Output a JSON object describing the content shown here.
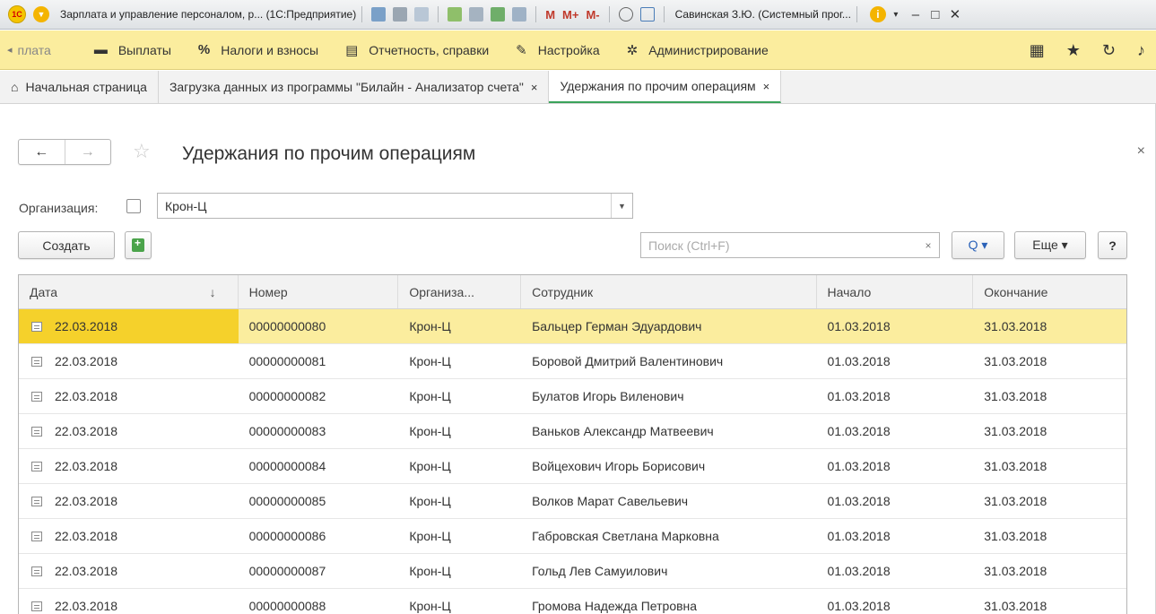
{
  "window": {
    "logo": "1С",
    "title": "Зарплата и управление персоналом, р... (1С:Предприятие)",
    "m_labels": [
      "M",
      "M+",
      "M-"
    ],
    "user": "Савинская З.Ю. (Системный прог...",
    "info": "i",
    "minimize": "–",
    "maximize": "□",
    "close": "✕"
  },
  "sections": {
    "items": [
      {
        "label": "плата",
        "icon": "arrow-left-icon",
        "glyph": "◂"
      },
      {
        "label": "Выплаты",
        "icon": "payments-icon",
        "glyph": "▬"
      },
      {
        "label": "Налоги и взносы",
        "icon": "percent-icon",
        "glyph": "%"
      },
      {
        "label": "Отчетность, справки",
        "icon": "reports-icon",
        "glyph": "▤"
      },
      {
        "label": "Настройка",
        "icon": "wrench-icon",
        "glyph": "✎"
      },
      {
        "label": "Администрирование",
        "icon": "gear-icon",
        "glyph": "✲"
      }
    ],
    "right_icons": [
      "grid-icon",
      "star-icon",
      "history-icon",
      "bell-icon"
    ]
  },
  "tabs": {
    "home": "Начальная страница",
    "items": [
      {
        "label": "Загрузка данных из программы \"Билайн - Анализатор счета\"",
        "close": "×"
      },
      {
        "label": "Удержания по прочим операциям",
        "close": "×"
      }
    ]
  },
  "form": {
    "title": "Удержания по прочим операциям",
    "back": "←",
    "forward": "→",
    "favorite": "☆",
    "close": "×"
  },
  "filter": {
    "org_label": "Организация:",
    "org_value": "Крон-Ц",
    "org_checked": false
  },
  "toolbar": {
    "create_label": "Создать",
    "search_placeholder": "Поиск (Ctrl+F)",
    "search_clear": "×",
    "find_label": "Q ▾",
    "more_label": "Еще ▾",
    "help_label": "?"
  },
  "table": {
    "columns": [
      "Дата",
      "Номер",
      "Организа...",
      "Сотрудник",
      "Начало",
      "Окончание"
    ],
    "sort_indicator": "↓",
    "selected_row": 0,
    "rows": [
      {
        "date": "22.03.2018",
        "number": "00000000080",
        "org": "Крон-Ц",
        "employee": "Бальцер Герман Эдуардович",
        "start": "01.03.2018",
        "end": "31.03.2018"
      },
      {
        "date": "22.03.2018",
        "number": "00000000081",
        "org": "Крон-Ц",
        "employee": "Боровой Дмитрий Валентинович",
        "start": "01.03.2018",
        "end": "31.03.2018"
      },
      {
        "date": "22.03.2018",
        "number": "00000000082",
        "org": "Крон-Ц",
        "employee": "Булатов Игорь Виленович",
        "start": "01.03.2018",
        "end": "31.03.2018"
      },
      {
        "date": "22.03.2018",
        "number": "00000000083",
        "org": "Крон-Ц",
        "employee": "Ваньков Александр Матвеевич",
        "start": "01.03.2018",
        "end": "31.03.2018"
      },
      {
        "date": "22.03.2018",
        "number": "00000000084",
        "org": "Крон-Ц",
        "employee": "Войцехович Игорь Борисович",
        "start": "01.03.2018",
        "end": "31.03.2018"
      },
      {
        "date": "22.03.2018",
        "number": "00000000085",
        "org": "Крон-Ц",
        "employee": "Волков Марат Савельевич",
        "start": "01.03.2018",
        "end": "31.03.2018"
      },
      {
        "date": "22.03.2018",
        "number": "00000000086",
        "org": "Крон-Ц",
        "employee": "Габровская Светлана Марковна",
        "start": "01.03.2018",
        "end": "31.03.2018"
      },
      {
        "date": "22.03.2018",
        "number": "00000000087",
        "org": "Крон-Ц",
        "employee": "Гольд Лев Самуилович",
        "start": "01.03.2018",
        "end": "31.03.2018"
      },
      {
        "date": "22.03.2018",
        "number": "00000000088",
        "org": "Крон-Ц",
        "employee": "Громова Надежда Петровна",
        "start": "01.03.2018",
        "end": "31.03.2018"
      }
    ]
  },
  "colors": {
    "section_bg": "#fbed9e",
    "selected_row": "#fbed9e",
    "selected_cell": "#f5d12b",
    "active_tab_underline": "#3aa35a"
  }
}
